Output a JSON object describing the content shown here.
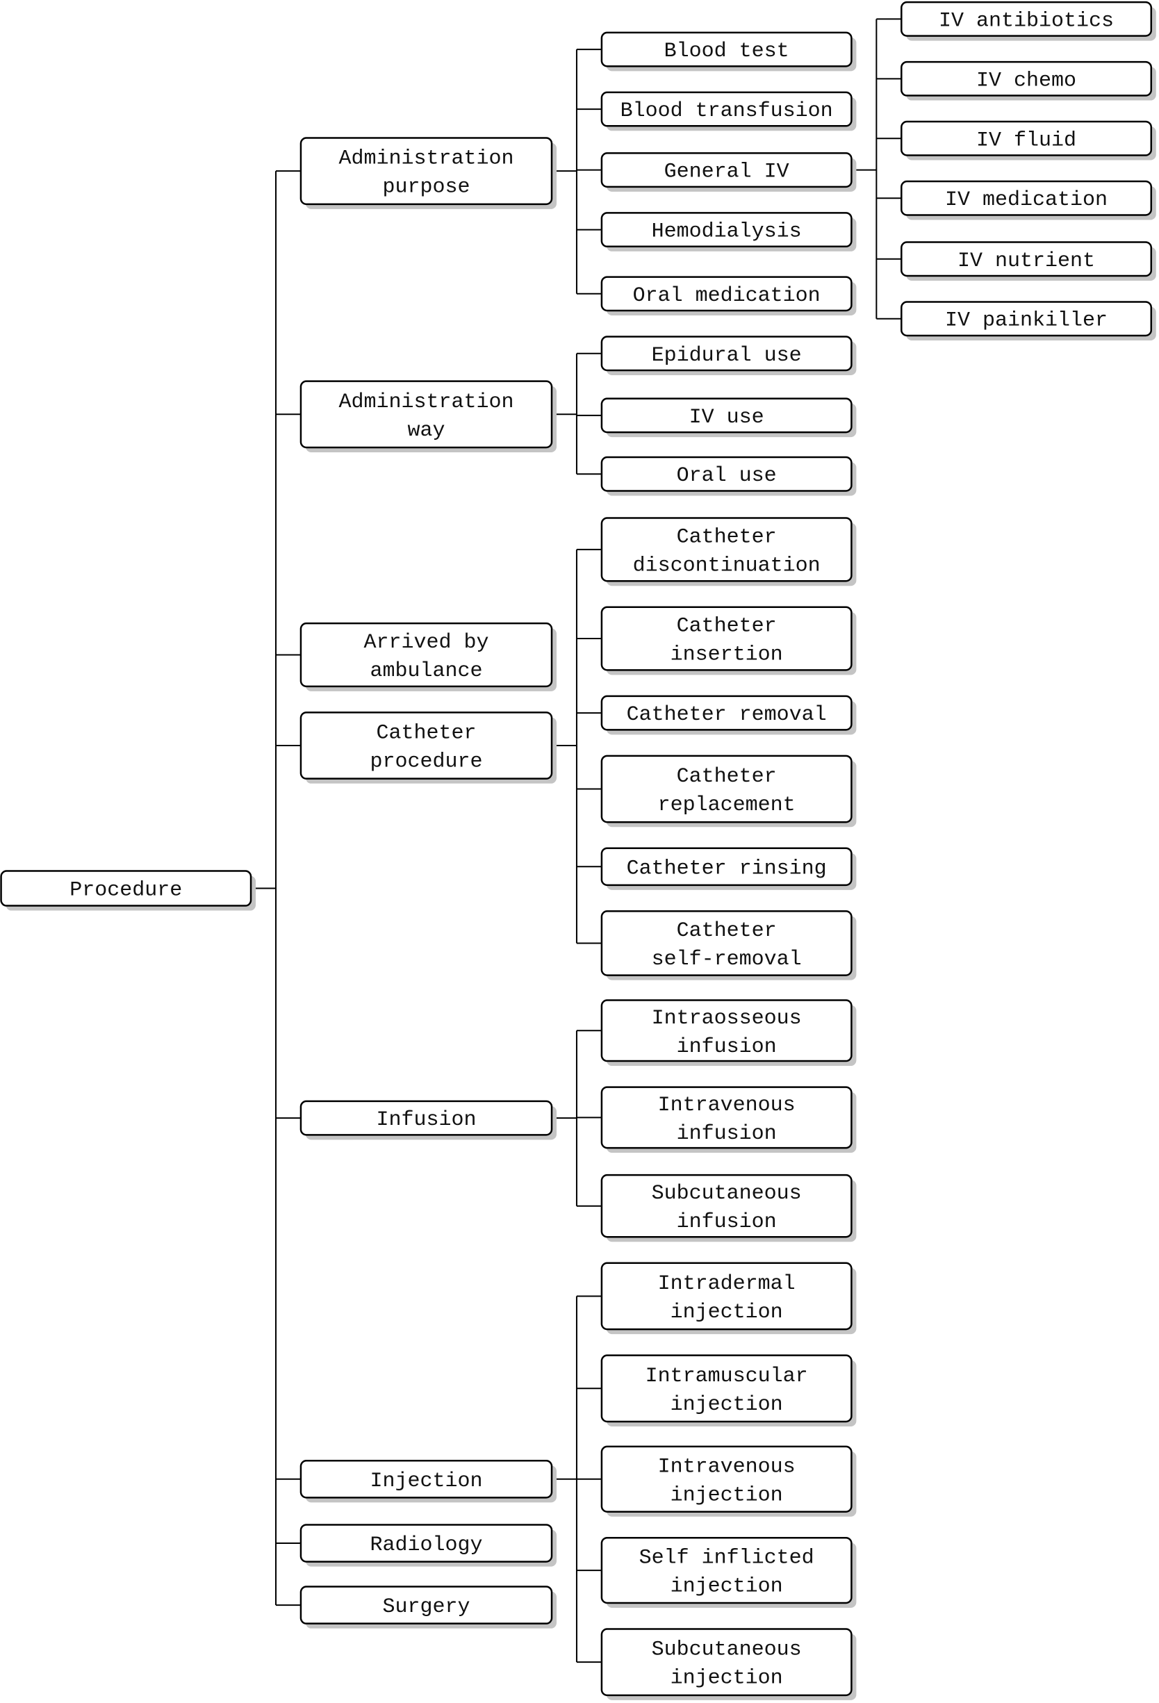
{
  "diagram": {
    "type": "tree",
    "root": {
      "label": [
        "Procedure"
      ],
      "children": [
        {
          "label": [
            "Administration",
            "purpose"
          ],
          "children": [
            {
              "label": [
                "Blood test"
              ]
            },
            {
              "label": [
                "Blood transfusion"
              ]
            },
            {
              "label": [
                "General IV"
              ],
              "children": [
                {
                  "label": [
                    "IV antibiotics"
                  ]
                },
                {
                  "label": [
                    "IV chemo"
                  ]
                },
                {
                  "label": [
                    "IV fluid"
                  ]
                },
                {
                  "label": [
                    "IV medication"
                  ]
                },
                {
                  "label": [
                    "IV nutrient"
                  ]
                },
                {
                  "label": [
                    "IV painkiller"
                  ]
                }
              ]
            },
            {
              "label": [
                "Hemodialysis"
              ]
            },
            {
              "label": [
                "Oral medication"
              ]
            }
          ]
        },
        {
          "label": [
            "Administration",
            "way"
          ],
          "children": [
            {
              "label": [
                "Epidural use"
              ]
            },
            {
              "label": [
                "IV use"
              ]
            },
            {
              "label": [
                "Oral use"
              ]
            }
          ]
        },
        {
          "label": [
            "Arrived by",
            "ambulance"
          ]
        },
        {
          "label": [
            "Catheter",
            "procedure"
          ],
          "children": [
            {
              "label": [
                "Catheter",
                "discontinuation"
              ]
            },
            {
              "label": [
                "Catheter",
                "insertion"
              ]
            },
            {
              "label": [
                "Catheter removal"
              ]
            },
            {
              "label": [
                "Catheter",
                "replacement"
              ]
            },
            {
              "label": [
                "Catheter rinsing"
              ]
            },
            {
              "label": [
                "Catheter",
                "self-removal"
              ]
            }
          ]
        },
        {
          "label": [
            "Infusion"
          ],
          "children": [
            {
              "label": [
                "Intraosseous",
                "infusion"
              ]
            },
            {
              "label": [
                "Intravenous",
                "infusion"
              ]
            },
            {
              "label": [
                "Subcutaneous",
                "infusion"
              ]
            }
          ]
        },
        {
          "label": [
            "Injection"
          ],
          "children": [
            {
              "label": [
                "Intradermal",
                "injection"
              ]
            },
            {
              "label": [
                "Intramuscular",
                "injection"
              ]
            },
            {
              "label": [
                "Intravenous",
                "injection"
              ]
            },
            {
              "label": [
                "Self inflicted",
                "injection"
              ]
            },
            {
              "label": [
                "Subcutaneous",
                "injection"
              ]
            }
          ]
        },
        {
          "label": [
            "Radiology"
          ]
        },
        {
          "label": [
            "Surgery"
          ]
        }
      ]
    }
  }
}
